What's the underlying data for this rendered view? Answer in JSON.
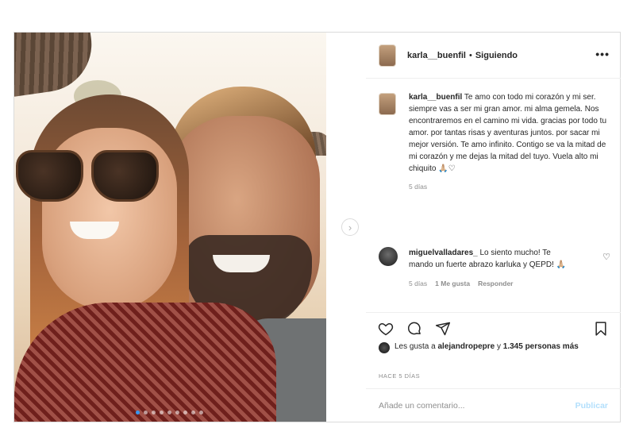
{
  "post": {
    "username": "karla__buenfil",
    "separator": "•",
    "follow_status": "Siguiendo",
    "more_icon": "more-horizontal-icon",
    "caption": {
      "username": "karla__buenfil",
      "text": "Te amo con todo mi corazón y mi ser. siempre vas a ser mi gran amor. mi alma gemela. Nos encontraremos en el camino mi vida. gracias por todo tu amor. por tantas risas y aventuras juntos. por sacar mi mejor versión. Te amo infinito. Contigo se va la mitad de mi corazón y me dejas la mitad del tuyo. Vuela alto mi chiquito 🙏🏼♡ ",
      "time": "5 días"
    },
    "comment": {
      "username": "miguelvalladares_",
      "text": "Lo siento mucho! Te mando un fuerte abrazo karluka y QEPD! 🙏🏼",
      "time": "5 días",
      "likes": "1 Me gusta",
      "reply": "Responder"
    },
    "likes": {
      "prefix": "Les gusta a",
      "user": "alejandropepre",
      "conj": "y",
      "others": "1.345 personas más"
    },
    "posted_ago": "HACE 5 DÍAS",
    "add_comment_placeholder": "Añade un comentario...",
    "publish_label": "Publicar",
    "carousel": {
      "count": 9,
      "active_index": 0
    }
  },
  "icons": {
    "like": "heart-icon",
    "comment": "comment-icon",
    "share": "share-icon",
    "save": "bookmark-icon",
    "next": "chevron-right-icon"
  },
  "colors": {
    "link_disabled": "#b2dffc",
    "muted": "#8e8e8e",
    "accent": "#3897f0"
  }
}
